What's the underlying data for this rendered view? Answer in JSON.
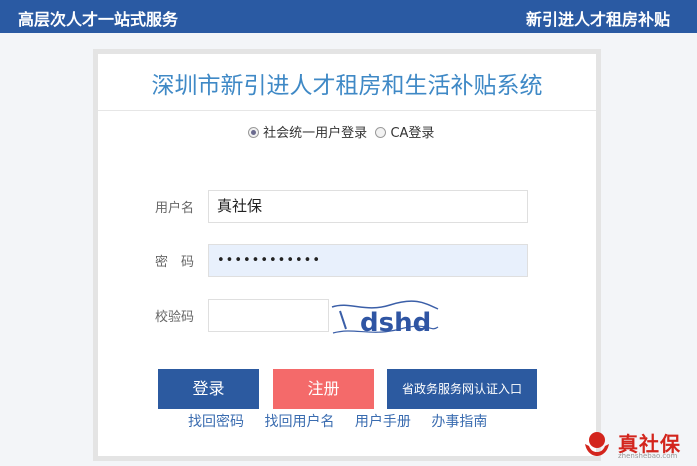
{
  "header": {
    "left_title": "高层次人才一站式服务",
    "right_title": "新引进人才租房补贴"
  },
  "card": {
    "title": "深圳市新引进人才租房和生活补贴系统"
  },
  "login_type": {
    "options": [
      "社会统一用户登录",
      "CA登录"
    ],
    "selected": "社会统一用户登录"
  },
  "form": {
    "username_label": "用户名",
    "username_value": "真社保",
    "password_label": "密　码",
    "password_value": "••••••••••••",
    "captcha_label": "校验码",
    "captcha_value": "",
    "captcha_image_text": "dshd"
  },
  "buttons": {
    "login": "登录",
    "register": "注册",
    "gov_portal": "省政务服务网认证入口"
  },
  "links": [
    "找回密码",
    "找回用户名",
    "用户手册",
    "办事指南"
  ],
  "logo": {
    "name": "真社保",
    "url": "zhenshebao.com"
  },
  "colors": {
    "header_bg": "#2a5aa3",
    "title": "#3f89c6",
    "primary_button": "#2c5aa0",
    "register_button": "#f46a6a",
    "brand_red": "#d3251d"
  }
}
